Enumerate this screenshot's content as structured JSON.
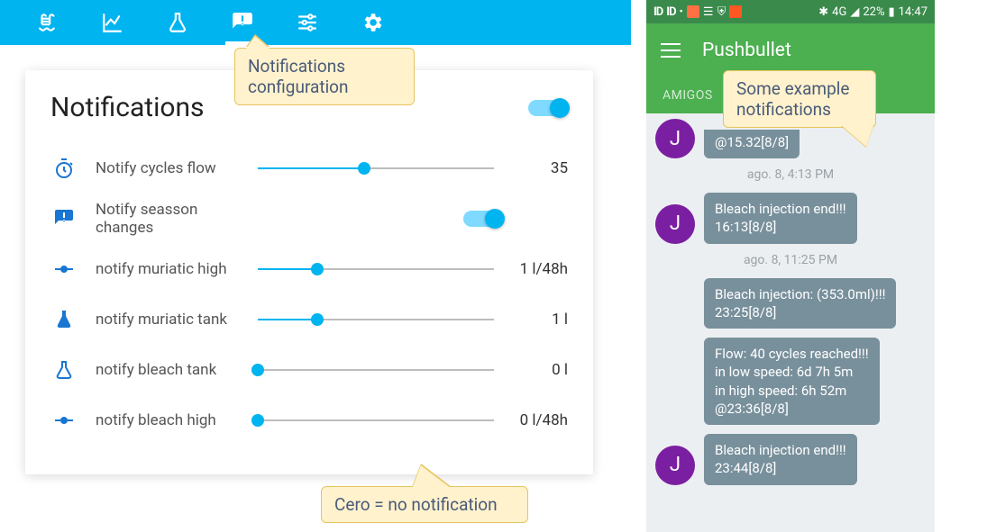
{
  "tabs": [
    "pool",
    "chart",
    "flask",
    "alert",
    "tune",
    "gear"
  ],
  "card": {
    "title": "Notifications",
    "rows": [
      {
        "icon": "timer",
        "label": "Notify cycles flow",
        "value": "35",
        "pct": 45,
        "type": "slider"
      },
      {
        "icon": "alert",
        "label": "Notify seasson changes",
        "value": "",
        "pct": 0,
        "type": "toggle"
      },
      {
        "icon": "node",
        "label": "notify muriatic high",
        "value": "1 l/48h",
        "pct": 25,
        "type": "slider"
      },
      {
        "icon": "flaskf",
        "label": "notify muriatic tank",
        "value": "1 l",
        "pct": 25,
        "type": "slider"
      },
      {
        "icon": "flasko",
        "label": "notify bleach tank",
        "value": "0 l",
        "pct": 0,
        "type": "slider"
      },
      {
        "icon": "node",
        "label": "notify bleach high",
        "value": "0 l/48h",
        "pct": 0,
        "type": "slider"
      }
    ]
  },
  "callouts": {
    "c1": "Notifications configuration",
    "c2": "Cero = no notification",
    "c3": "Some example notifications"
  },
  "phone": {
    "status_time": "14:47",
    "status_batt": "22%",
    "status_net": "4G",
    "app_title": "Pushbullet",
    "tab_label": "AMIGOS",
    "avatar_letter": "J",
    "items": [
      {
        "kind": "bubble_cut",
        "text": "@15.32[8/8]",
        "avatar": true
      },
      {
        "kind": "time",
        "text": "ago. 8, 4:13 PM"
      },
      {
        "kind": "bubble",
        "text": "Bleach injection end!!!\n16:13[8/8]",
        "avatar": true
      },
      {
        "kind": "time",
        "text": "ago. 8, 11:25 PM"
      },
      {
        "kind": "bubble",
        "text": "Bleach injection: (353.0ml)!!!\n23:25[8/8]",
        "avatar": false
      },
      {
        "kind": "bubble",
        "text": "Flow: 40 cycles reached!!!\nin low speed: 6d 7h 5m\nin high speed: 6h 52m\n@23:36[8/8]",
        "avatar": false
      },
      {
        "kind": "bubble",
        "text": "Bleach injection end!!!\n23:44[8/8]",
        "avatar": true
      }
    ]
  }
}
